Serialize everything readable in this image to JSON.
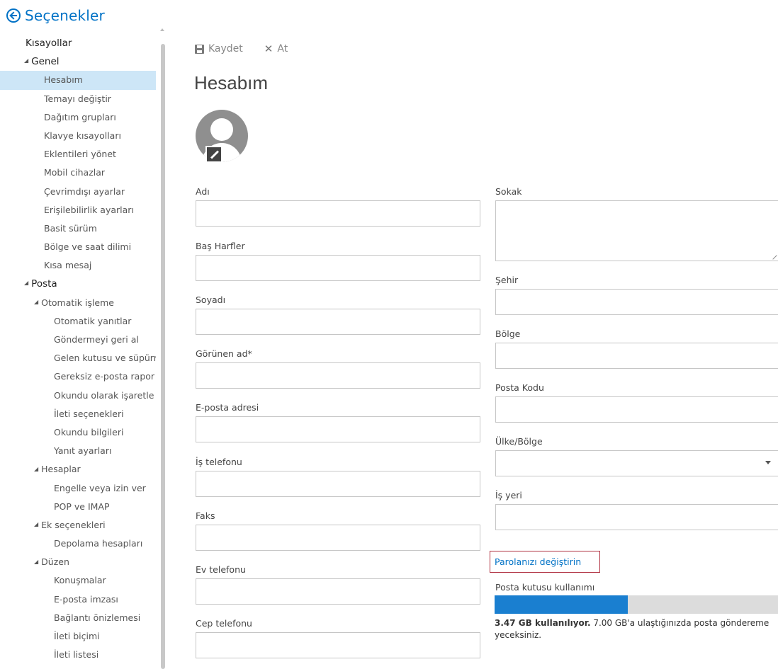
{
  "header": {
    "title": "Seçenekler"
  },
  "sidebar": {
    "items": [
      {
        "label": "Kısayollar",
        "level": 0,
        "section": false,
        "caret": false,
        "selected": false
      },
      {
        "label": "Genel",
        "level": 0,
        "section": true,
        "caret": true,
        "selected": false
      },
      {
        "label": "Hesabım",
        "level": 1,
        "section": false,
        "caret": false,
        "selected": true
      },
      {
        "label": "Temayı değiştir",
        "level": 1,
        "section": false,
        "caret": false,
        "selected": false
      },
      {
        "label": "Dağıtım grupları",
        "level": 1,
        "section": false,
        "caret": false,
        "selected": false
      },
      {
        "label": "Klavye kısayolları",
        "level": 1,
        "section": false,
        "caret": false,
        "selected": false
      },
      {
        "label": "Eklentileri yönet",
        "level": 1,
        "section": false,
        "caret": false,
        "selected": false
      },
      {
        "label": "Mobil cihazlar",
        "level": 1,
        "section": false,
        "caret": false,
        "selected": false
      },
      {
        "label": "Çevrimdışı ayarlar",
        "level": 1,
        "section": false,
        "caret": false,
        "selected": false
      },
      {
        "label": "Erişilebilirlik ayarları",
        "level": 1,
        "section": false,
        "caret": false,
        "selected": false
      },
      {
        "label": "Basit sürüm",
        "level": 1,
        "section": false,
        "caret": false,
        "selected": false
      },
      {
        "label": "Bölge ve saat dilimi",
        "level": 1,
        "section": false,
        "caret": false,
        "selected": false
      },
      {
        "label": "Kısa mesaj",
        "level": 1,
        "section": false,
        "caret": false,
        "selected": false
      },
      {
        "label": "Posta",
        "level": 0,
        "section": true,
        "caret": true,
        "selected": false
      },
      {
        "label": "Otomatik işleme",
        "level": 1,
        "section": false,
        "caret": true,
        "selected": false
      },
      {
        "label": "Otomatik yanıtlar",
        "level": 2,
        "section": false,
        "caret": false,
        "selected": false
      },
      {
        "label": "Göndermeyi geri al",
        "level": 2,
        "section": false,
        "caret": false,
        "selected": false
      },
      {
        "label": "Gelen kutusu ve süpürr",
        "level": 2,
        "section": false,
        "caret": false,
        "selected": false
      },
      {
        "label": "Gereksiz e-posta rapor",
        "level": 2,
        "section": false,
        "caret": false,
        "selected": false
      },
      {
        "label": "Okundu olarak işaretle",
        "level": 2,
        "section": false,
        "caret": false,
        "selected": false
      },
      {
        "label": "İleti seçenekleri",
        "level": 2,
        "section": false,
        "caret": false,
        "selected": false
      },
      {
        "label": "Okundu bilgileri",
        "level": 2,
        "section": false,
        "caret": false,
        "selected": false
      },
      {
        "label": "Yanıt ayarları",
        "level": 2,
        "section": false,
        "caret": false,
        "selected": false
      },
      {
        "label": "Hesaplar",
        "level": 1,
        "section": false,
        "caret": true,
        "selected": false
      },
      {
        "label": "Engelle veya izin ver",
        "level": 2,
        "section": false,
        "caret": false,
        "selected": false
      },
      {
        "label": "POP ve IMAP",
        "level": 2,
        "section": false,
        "caret": false,
        "selected": false
      },
      {
        "label": "Ek seçenekleri",
        "level": 1,
        "section": false,
        "caret": true,
        "selected": false
      },
      {
        "label": "Depolama hesapları",
        "level": 2,
        "section": false,
        "caret": false,
        "selected": false
      },
      {
        "label": "Düzen",
        "level": 1,
        "section": false,
        "caret": true,
        "selected": false
      },
      {
        "label": "Konuşmalar",
        "level": 2,
        "section": false,
        "caret": false,
        "selected": false
      },
      {
        "label": "E-posta imzası",
        "level": 2,
        "section": false,
        "caret": false,
        "selected": false
      },
      {
        "label": "Bağlantı önizlemesi",
        "level": 2,
        "section": false,
        "caret": false,
        "selected": false
      },
      {
        "label": "İleti biçimi",
        "level": 2,
        "section": false,
        "caret": false,
        "selected": false
      },
      {
        "label": "İleti listesi",
        "level": 2,
        "section": false,
        "caret": false,
        "selected": false
      }
    ]
  },
  "toolbar": {
    "save_label": "Kaydet",
    "discard_label": "At"
  },
  "page": {
    "title": "Hesabım"
  },
  "form": {
    "left": [
      {
        "label": "Adı",
        "value": ""
      },
      {
        "label": "Baş Harfler",
        "value": ""
      },
      {
        "label": "Soyadı",
        "value": ""
      },
      {
        "label": "Görünen ad*",
        "value": ""
      },
      {
        "label": "E-posta adresi",
        "value": ""
      },
      {
        "label": "İş telefonu",
        "value": ""
      },
      {
        "label": "Faks",
        "value": ""
      },
      {
        "label": "Ev telefonu",
        "value": ""
      },
      {
        "label": "Cep telefonu",
        "value": ""
      }
    ],
    "right": [
      {
        "label": "Sokak",
        "value": "",
        "type": "textarea"
      },
      {
        "label": "Şehir",
        "value": "",
        "type": "input"
      },
      {
        "label": "Bölge",
        "value": "",
        "type": "input"
      },
      {
        "label": "Posta Kodu",
        "value": "",
        "type": "input"
      },
      {
        "label": "Ülke/Bölge",
        "value": "",
        "type": "select"
      },
      {
        "label": "İş yeri",
        "value": "",
        "type": "input"
      }
    ]
  },
  "password": {
    "label": "Parolanızı değiştirin"
  },
  "mailbox": {
    "label": "Posta kutusu kullanımı",
    "used_text": "3.47 GB kullanılıyor.",
    "limit_text": " 7.00 GB'a ulaştığınızda posta göndereme yeceksiniz.",
    "used_fraction": 0.47,
    "fill_color": "#1a7fd0"
  }
}
